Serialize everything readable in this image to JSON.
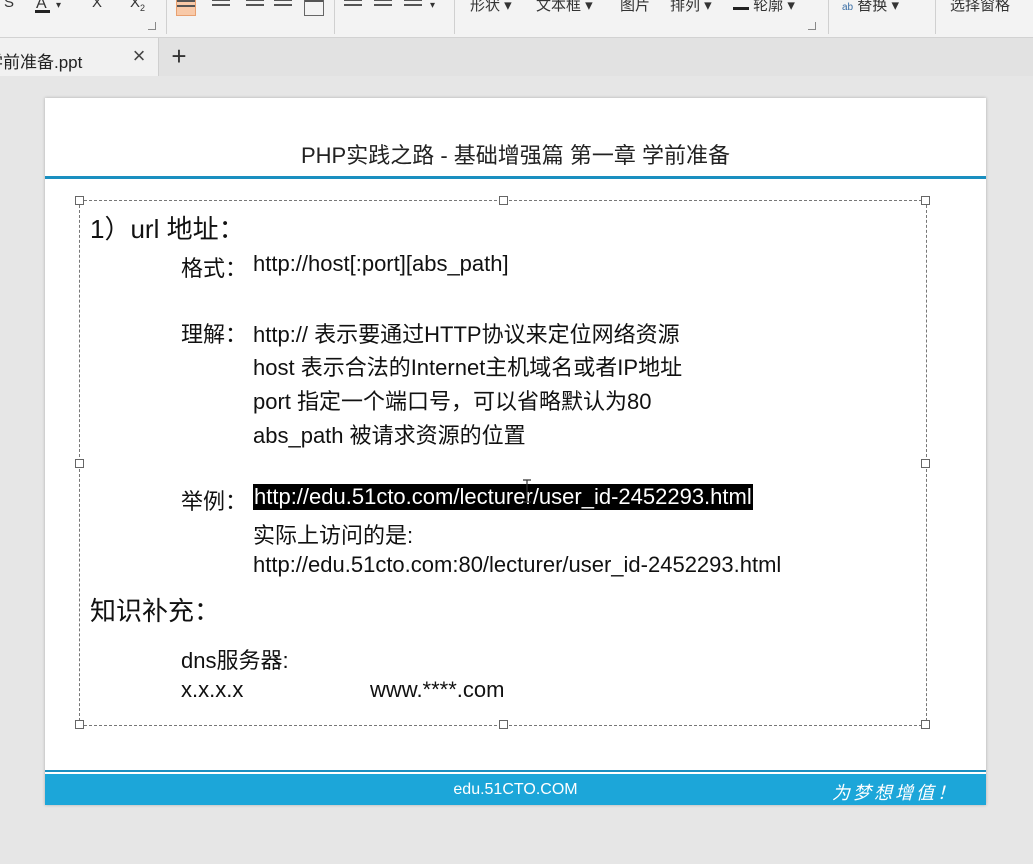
{
  "ribbon": {
    "shape_label": "形状",
    "textbox_label": "文本框",
    "picture_label": "图片",
    "arrange_label": "排列",
    "outline_label": "轮廓",
    "replace_label": "替换",
    "select_pane_label": "选择窗格"
  },
  "tabs": [
    {
      "title": "学前准备.ppt"
    }
  ],
  "tab_close_glyph": "×",
  "tab_add_glyph": "+",
  "slide": {
    "title": "PHP实践之路 - 基础增强篇 第一章 学前准备",
    "heading_url": "1）url 地址：",
    "format_label": "格式：",
    "format_value": "http://host[:port][abs_path]",
    "understand_label": "理解：",
    "understand_lines": [
      "http:// 表示要通过HTTP协议来定位网络资源",
      "host 表示合法的Internet主机域名或者IP地址",
      "port 指定一个端口号，可以省略默认为80",
      "abs_path 被请求资源的位置"
    ],
    "example_label": "举例：",
    "example_url": "http://edu.51cto.com/lecturer/user_id-2452293.html",
    "actual_label": "实际上访问的是:",
    "actual_url": "http://edu.51cto.com:80/lecturer/user_id-2452293.html",
    "heading_knowledge": "知识补充：",
    "dns_label": "dns服务器:",
    "dns_ip": "x.x.x.x",
    "dns_domain": "www.****.com",
    "footer_site": "edu.51CTO.COM",
    "footer_slogan": "为梦想增值！"
  },
  "colors": {
    "accent_blue": "#1ca6d9",
    "rule_blue": "#1a8fc0",
    "selection_bg": "#000000"
  }
}
